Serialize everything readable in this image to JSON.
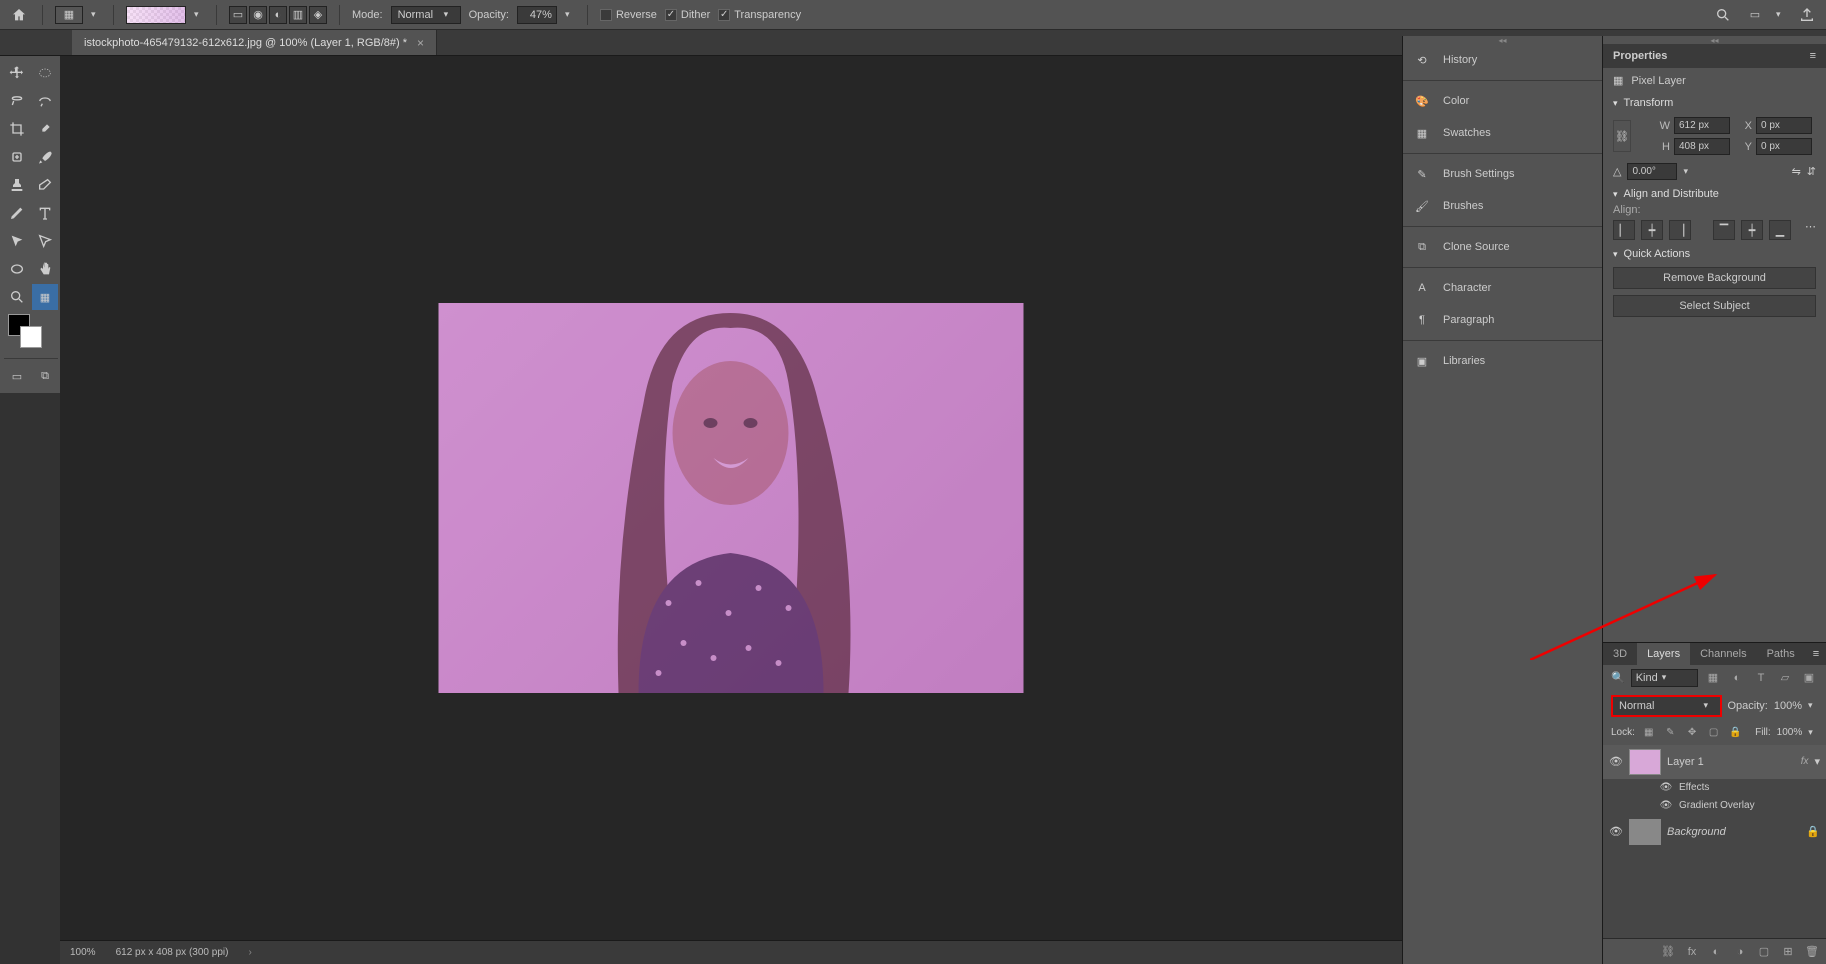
{
  "topbar": {
    "mode_label": "Mode:",
    "mode_value": "Normal",
    "opacity_label": "Opacity:",
    "opacity_value": "47%",
    "reverse": "Reverse",
    "dither": "Dither",
    "transparency": "Transparency"
  },
  "document": {
    "tab_title": "istockphoto-465479132-612x612.jpg @ 100% (Layer 1, RGB/8#) *"
  },
  "status": {
    "zoom": "100%",
    "dims": "612 px x 408 px (300 ppi)"
  },
  "panels": {
    "history": "History",
    "color": "Color",
    "swatches": "Swatches",
    "brush_settings": "Brush Settings",
    "brushes": "Brushes",
    "clone_source": "Clone Source",
    "character": "Character",
    "paragraph": "Paragraph",
    "libraries": "Libraries"
  },
  "properties": {
    "title": "Properties",
    "layer_type": "Pixel Layer",
    "transform": "Transform",
    "w_label": "W",
    "w_value": "612 px",
    "h_label": "H",
    "h_value": "408 px",
    "x_label": "X",
    "x_value": "0 px",
    "y_label": "Y",
    "y_value": "0 px",
    "angle": "0.00°",
    "align_title": "Align and Distribute",
    "align_label": "Align:",
    "quick_actions": "Quick Actions",
    "remove_bg": "Remove Background",
    "select_subject": "Select Subject"
  },
  "layers": {
    "tab_3d": "3D",
    "tab_layers": "Layers",
    "tab_channels": "Channels",
    "tab_paths": "Paths",
    "kind": "Kind",
    "blend_mode": "Normal",
    "opacity_label": "Opacity:",
    "opacity_value": "100%",
    "lock_label": "Lock:",
    "fill_label": "Fill:",
    "fill_value": "100%",
    "layer1": "Layer 1",
    "effects": "Effects",
    "grad_overlay": "Gradient Overlay",
    "background": "Background"
  }
}
